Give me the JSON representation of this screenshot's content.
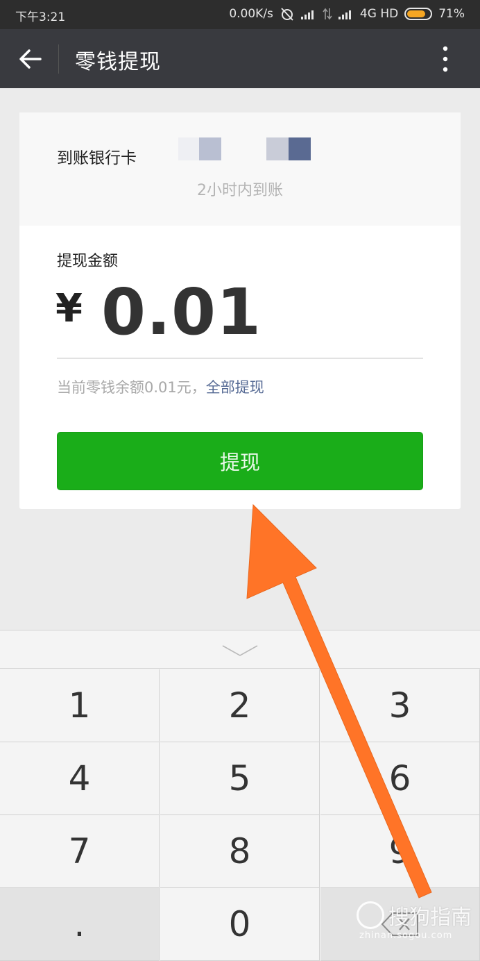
{
  "status_bar": {
    "time": "下午3:21",
    "net_speed": "0.00K/s",
    "network": "4G HD",
    "battery": "71%",
    "battery_color": "#f5a623",
    "icons": [
      "alarm-off-icon",
      "signal-icon",
      "data-arrows-icon",
      "signal-icon",
      "battery-icon"
    ]
  },
  "nav": {
    "title": "零钱提现",
    "back_icon": "arrow-left-icon",
    "more_icon": "more-vertical-icon"
  },
  "bank": {
    "label": "到账银行卡",
    "arrival_text": "2小时内到账"
  },
  "withdraw": {
    "amount_label": "提现金额",
    "currency_symbol": "¥",
    "amount": "0.01",
    "balance_text": "当前零钱余额0.01元，",
    "all_link": "全部提现",
    "button_label": "提现",
    "button_color": "#1aad19",
    "link_color": "#576b95"
  },
  "keypad": {
    "collapse_icon": "chevron-down-icon",
    "keys": [
      "1",
      "2",
      "3",
      "4",
      "5",
      "6",
      "7",
      "8",
      "9",
      ".",
      "0"
    ],
    "delete_icon": "backspace-icon"
  },
  "annotation": {
    "arrow_color": "#ff7427"
  },
  "watermark": {
    "name": "搜狗指南",
    "url": "zhinan.sogou.com"
  }
}
